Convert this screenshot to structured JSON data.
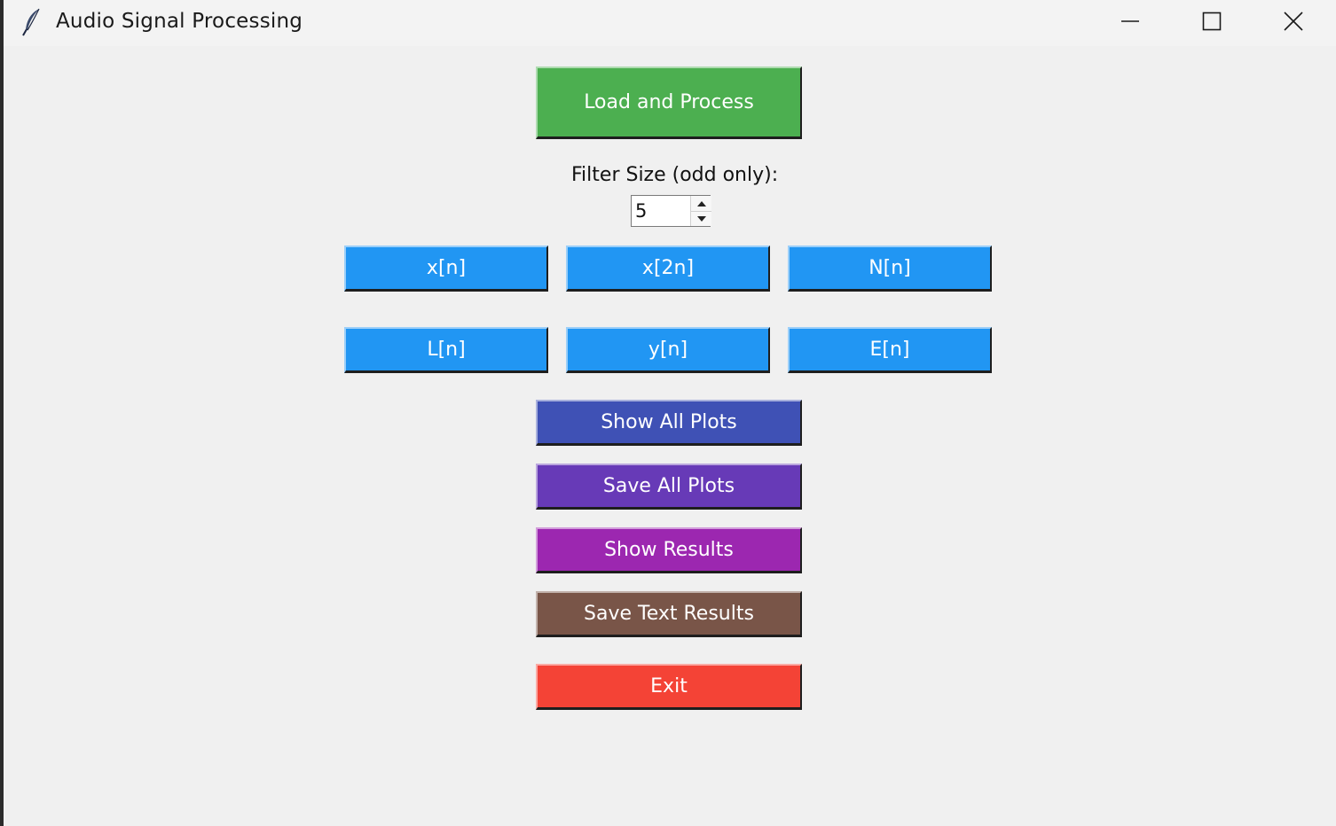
{
  "window": {
    "title": "Audio Signal Processing",
    "icon": "feather-icon",
    "controls": [
      "minimize-icon",
      "maximize-icon",
      "close-icon"
    ]
  },
  "buttons": {
    "load_process": {
      "label": "Load and Process",
      "color": "#4caf50"
    },
    "xn": {
      "label": "x[n]",
      "color": "#2196f3"
    },
    "x2n": {
      "label": "x[2n]",
      "color": "#2196f3"
    },
    "Nn": {
      "label": "N[n]",
      "color": "#2196f3"
    },
    "Ln": {
      "label": "L[n]",
      "color": "#2196f3"
    },
    "yn": {
      "label": "y[n]",
      "color": "#2196f3"
    },
    "En": {
      "label": "E[n]",
      "color": "#2196f3"
    },
    "show_all_plots": {
      "label": "Show All Plots",
      "color": "#3f51b5"
    },
    "save_all_plots": {
      "label": "Save All Plots",
      "color": "#673ab7"
    },
    "show_results": {
      "label": "Show Results",
      "color": "#9c27b0"
    },
    "save_text_results": {
      "label": "Save Text Results",
      "color": "#795548"
    },
    "exit": {
      "label": "Exit",
      "color": "#f44336"
    }
  },
  "filter": {
    "label": "Filter Size (odd only):",
    "value": "5"
  }
}
